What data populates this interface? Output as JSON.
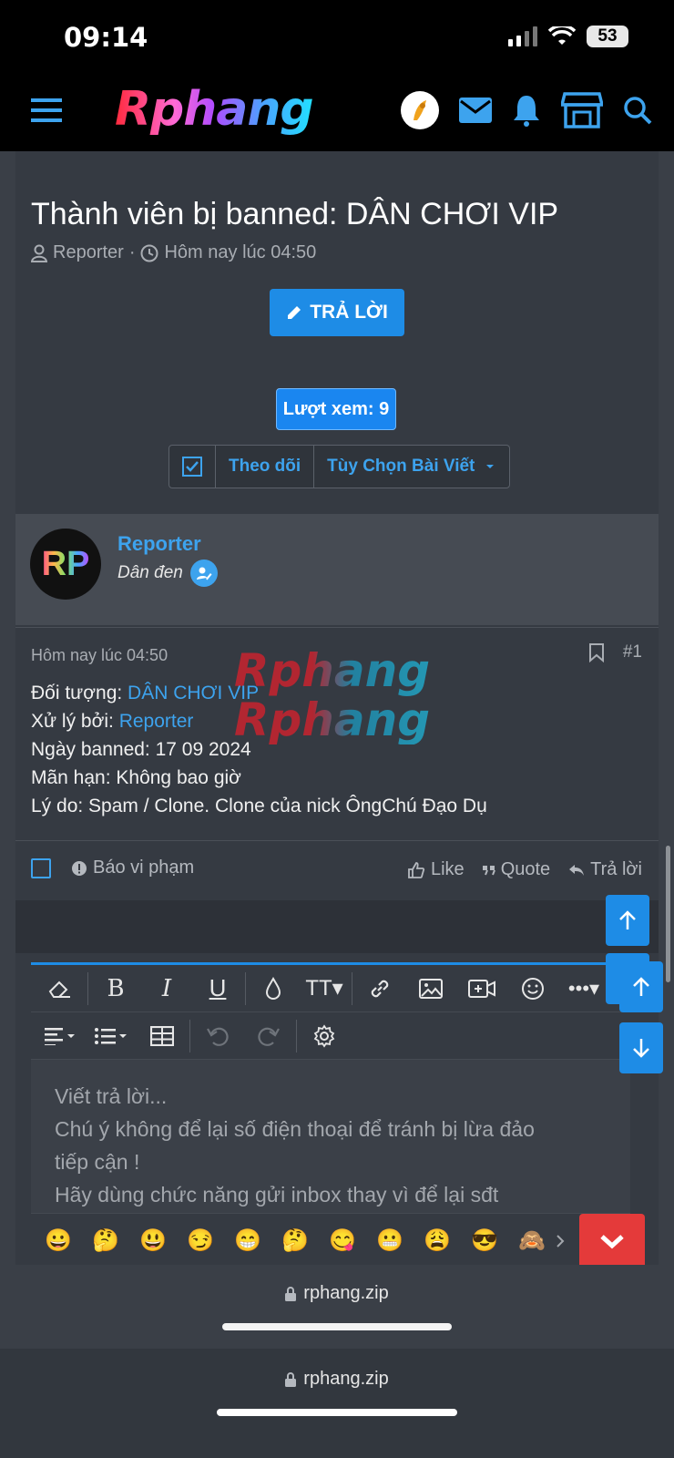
{
  "status": {
    "time": "09:14",
    "battery": "53"
  },
  "header": {
    "logo": "Rphang"
  },
  "thread": {
    "title": "Thành viên bị banned: DÂN CHƠI VIP",
    "author": "Reporter",
    "separator": "·",
    "date": "Hôm nay lúc 04:50",
    "reply_button": "TRẢ LỜI",
    "views": "Lượt xem: 9",
    "follow": "Theo dõi",
    "options": "Tùy Chọn Bài Viết"
  },
  "post": {
    "avatar_text": "RP",
    "author": "Reporter",
    "role": "Dân đen",
    "date": "Hôm nay lúc 04:50",
    "number": "#1",
    "watermark": "Rphang",
    "lines": {
      "target_label": "Đối tượng: ",
      "target_value": "DÂN CHƠI VIP",
      "handled_label": "Xử lý bởi: ",
      "handled_value": "Reporter",
      "banned_date": "Ngày banned: 17 09 2024",
      "expiry": "Mãn hạn: Không bao giờ",
      "reason": "Lý do: Spam / Clone. Clone của nick ÔngChú Đạo Dụ"
    },
    "actions": {
      "report": "Báo vi phạm",
      "like": "Like",
      "quote": "Quote",
      "reply": "Trả lời"
    }
  },
  "editor": {
    "placeholder_lines": [
      "Viết trả lời...",
      "Chú ý không để lại số điện thoại để tránh bị lừa đảo",
      "tiếp cận !",
      "Hãy dùng chức năng gửi inbox thay vì để lại sđt"
    ],
    "emojis": [
      "😀",
      "🤔",
      "😃",
      "😏",
      "😁",
      "🤔",
      "😋",
      "😬",
      "😩",
      "😎",
      "🙈"
    ]
  },
  "browser": {
    "url": "rphang.zip"
  },
  "colors": {
    "accent": "#1e8ce6",
    "link": "#3da3ee",
    "background": "#353a42"
  }
}
